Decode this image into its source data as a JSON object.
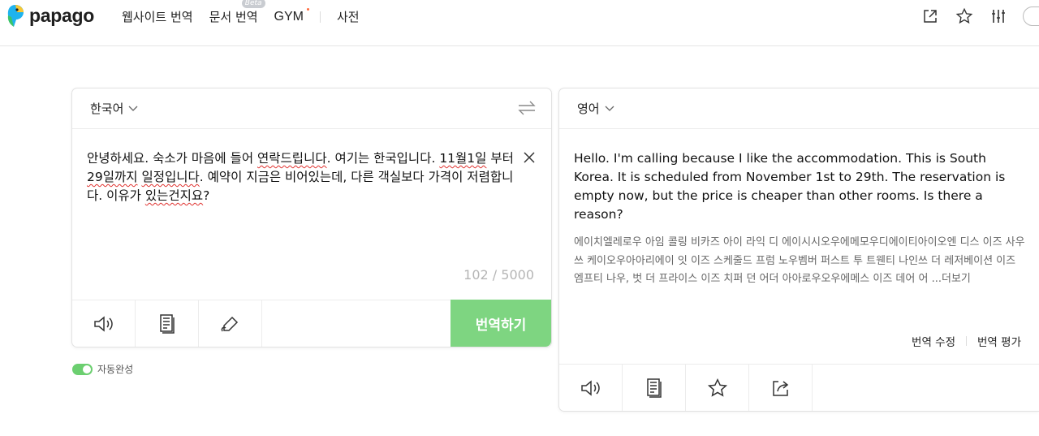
{
  "brand": {
    "logo_text": "papago"
  },
  "nav": {
    "website_translate": "웹사이트 번역",
    "document_translate": "문서 번역",
    "document_badge": "Beta",
    "gym": "GYM",
    "dictionary": "사전"
  },
  "header_icons": [
    "share-icon",
    "star-icon",
    "settings-sliders-icon",
    "user-icon"
  ],
  "source": {
    "language": "한국어",
    "text_parts": [
      "안녕하세요. 숙소가 마음에 들어 ",
      "연락드립니다",
      ". 여기는 한국입니다. ",
      "11월1일",
      " 부터 ",
      "29일까지",
      " ",
      "일정입니다",
      ". 예약이 지금은 비어있는데, 다른 객실보다 가격이 저렴합니다. 이유가 ",
      "있는건지요",
      "?"
    ],
    "char_count": "102 / 5000",
    "translate_button": "번역하기"
  },
  "target": {
    "language": "영어",
    "translation": "Hello. I'm calling because I like the accommodation. This is South Korea. It is scheduled from November 1st to 29th. The reservation is empty now, but the price is cheaper than other rooms. Is there a reason?",
    "pronunciation": "에이치엘레로우 아임 콜링 비카즈 아이 라익 디 에이시시오우에메모우디에이티아이오엔 디스 이즈 사우쓰 케이오우아아리에이 잇 이즈 스케줄드 프럼 노우벰버 퍼스트 투 트웬티 나인쓰 더 레저베이션 이즈 엠프티 나우, 벗 더 프라이스 이즈 치퍼 던 어더 아아로우오우에메스 이즈 데어 어 ...",
    "more_label": "더보기",
    "edit_label": "번역 수정",
    "rate_label": "번역 평가"
  },
  "autocomplete": {
    "label": "자동완성",
    "enabled": true
  },
  "colors": {
    "accent": "#7ed581",
    "toggle": "#6ccf70",
    "spell_error": "#e0322f"
  }
}
